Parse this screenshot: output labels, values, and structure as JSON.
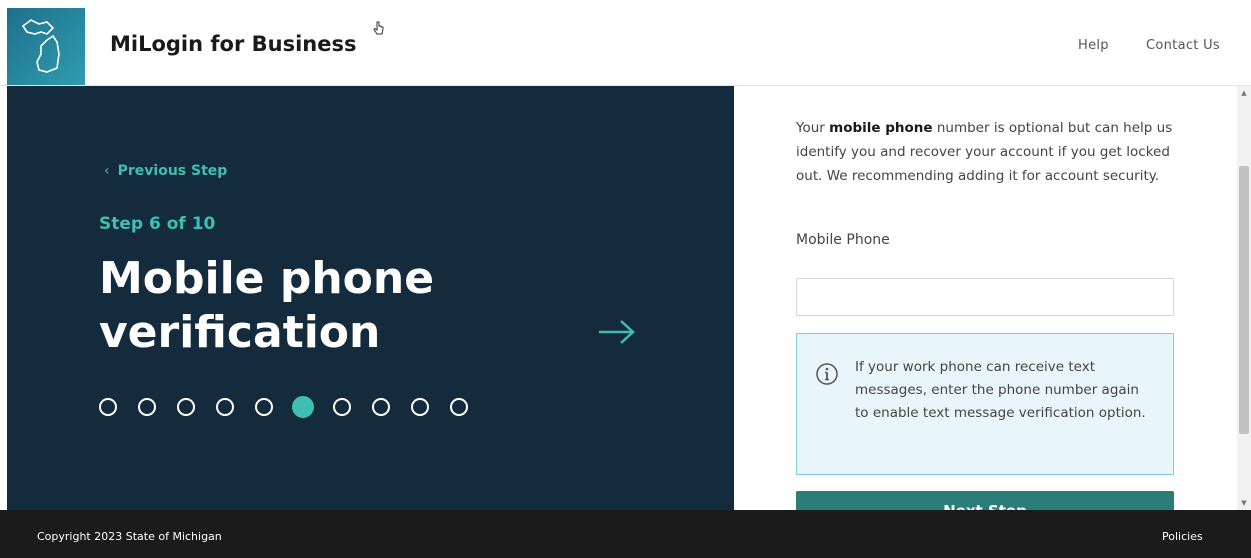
{
  "header": {
    "brand": "MiLogin for Business",
    "nav": {
      "help": "Help",
      "contact": "Contact Us"
    }
  },
  "progress": {
    "prev_label": "Previous Step",
    "step_text": "Step 6 of 10",
    "title": "Mobile phone verification",
    "total_steps": 10,
    "current_step": 6
  },
  "form": {
    "intro_pre": "Your ",
    "intro_bold": "mobile phone",
    "intro_post": " number is optional but can help us identify you and recover your account if you get locked out. We recommending adding it for account security.",
    "field_label": "Mobile Phone",
    "phone_value": "",
    "info_text": "If your work phone can receive text messages, enter the phone number again to enable text message verification option.",
    "next_label": "Next Step"
  },
  "footer": {
    "copyright": "Copyright 2023 State of Michigan",
    "policies": "Policies"
  },
  "colors": {
    "panel_bg": "#142b3e",
    "accent": "#3fbfb3",
    "button": "#2a7d78",
    "info_bg": "#e8f6fb",
    "footer_bg": "#1b1b1b"
  },
  "icons": [
    "michigan-logo-icon",
    "hand-cursor-icon",
    "chevron-left-icon",
    "arrow-right-icon",
    "info-icon",
    "scroll-up-icon",
    "scroll-down-icon"
  ]
}
